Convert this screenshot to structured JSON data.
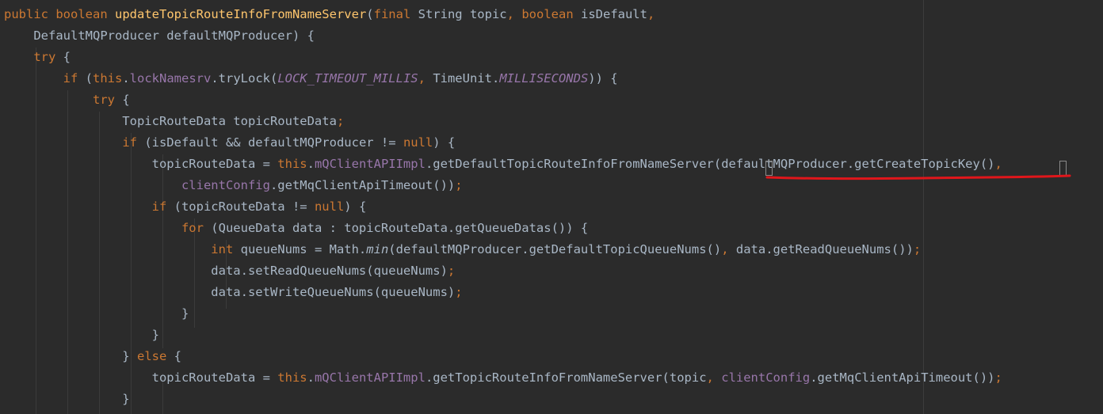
{
  "editor": {
    "colors": {
      "background": "#2b2b2b",
      "keyword": "#cc7832",
      "method_declaration": "#ffc66d",
      "field": "#9876aa",
      "default_text": "#a9b7c6",
      "annotation_underline": "#e0161b"
    },
    "lines": [
      [
        {
          "t": "public",
          "k": "kw"
        },
        {
          "t": " ",
          "k": "plain"
        },
        {
          "t": "boolean",
          "k": "kw"
        },
        {
          "t": " ",
          "k": "plain"
        },
        {
          "t": "updateTopicRouteInfoFromNameServer",
          "k": "fn"
        },
        {
          "t": "(",
          "k": "plain"
        },
        {
          "t": "final",
          "k": "kw"
        },
        {
          "t": " String topic",
          "k": "plain"
        },
        {
          "t": ",",
          "k": "punc"
        },
        {
          "t": " ",
          "k": "plain"
        },
        {
          "t": "boolean",
          "k": "kw"
        },
        {
          "t": " isDefault",
          "k": "plain"
        },
        {
          "t": ",",
          "k": "punc"
        }
      ],
      [
        {
          "t": "    DefaultMQProducer defaultMQProducer) {",
          "k": "plain"
        }
      ],
      [
        {
          "t": "    ",
          "k": "plain"
        },
        {
          "t": "try",
          "k": "kw"
        },
        {
          "t": " {",
          "k": "plain"
        }
      ],
      [
        {
          "t": "        ",
          "k": "plain"
        },
        {
          "t": "if",
          "k": "kw"
        },
        {
          "t": " (",
          "k": "plain"
        },
        {
          "t": "this",
          "k": "kw"
        },
        {
          "t": ".",
          "k": "plain"
        },
        {
          "t": "lockNamesrv",
          "k": "fld"
        },
        {
          "t": ".tryLock(",
          "k": "plain"
        },
        {
          "t": "LOCK_TIMEOUT_MILLIS",
          "k": "const"
        },
        {
          "t": ",",
          "k": "punc"
        },
        {
          "t": " TimeUnit.",
          "k": "plain"
        },
        {
          "t": "MILLISECONDS",
          "k": "const"
        },
        {
          "t": ")) {",
          "k": "plain"
        }
      ],
      [
        {
          "t": "            ",
          "k": "plain"
        },
        {
          "t": "try",
          "k": "kw"
        },
        {
          "t": " {",
          "k": "plain"
        }
      ],
      [
        {
          "t": "                TopicRouteData topicRouteData",
          "k": "plain"
        },
        {
          "t": ";",
          "k": "punc"
        }
      ],
      [
        {
          "t": "                ",
          "k": "plain"
        },
        {
          "t": "if",
          "k": "kw"
        },
        {
          "t": " (isDefault && defaultMQProducer != ",
          "k": "plain"
        },
        {
          "t": "null",
          "k": "kw"
        },
        {
          "t": ") {",
          "k": "plain"
        }
      ],
      [
        {
          "t": "                    topicRouteData = ",
          "k": "plain"
        },
        {
          "t": "this",
          "k": "kw"
        },
        {
          "t": ".",
          "k": "plain"
        },
        {
          "t": "mQClientAPIImpl",
          "k": "fld"
        },
        {
          "t": ".getDefaultTopicRouteInfoFromNameServer(defaultMQProducer.getCreateTopicKey()",
          "k": "plain"
        },
        {
          "t": ",",
          "k": "punc"
        }
      ],
      [
        {
          "t": "                        ",
          "k": "plain"
        },
        {
          "t": "clientConfig",
          "k": "fld"
        },
        {
          "t": ".getMqClientApiTimeout())",
          "k": "plain"
        },
        {
          "t": ";",
          "k": "punc"
        }
      ],
      [
        {
          "t": "                    ",
          "k": "plain"
        },
        {
          "t": "if",
          "k": "kw"
        },
        {
          "t": " (topicRouteData != ",
          "k": "plain"
        },
        {
          "t": "null",
          "k": "kw"
        },
        {
          "t": ") {",
          "k": "plain"
        }
      ],
      [
        {
          "t": "                        ",
          "k": "plain"
        },
        {
          "t": "for",
          "k": "kw"
        },
        {
          "t": " (QueueData data : topicRouteData.getQueueDatas()) {",
          "k": "plain"
        }
      ],
      [
        {
          "t": "                            ",
          "k": "plain"
        },
        {
          "t": "int",
          "k": "kw"
        },
        {
          "t": " queueNums = Math.",
          "k": "plain"
        },
        {
          "t": "min",
          "k": "static"
        },
        {
          "t": "(defaultMQProducer.getDefaultTopicQueueNums()",
          "k": "plain"
        },
        {
          "t": ",",
          "k": "punc"
        },
        {
          "t": " data.getReadQueueNums())",
          "k": "plain"
        },
        {
          "t": ";",
          "k": "punc"
        }
      ],
      [
        {
          "t": "                            data.setReadQueueNums(queueNums)",
          "k": "plain"
        },
        {
          "t": ";",
          "k": "punc"
        }
      ],
      [
        {
          "t": "                            data.setWriteQueueNums(queueNums)",
          "k": "plain"
        },
        {
          "t": ";",
          "k": "punc"
        }
      ],
      [
        {
          "t": "                        }",
          "k": "plain"
        }
      ],
      [
        {
          "t": "                    }",
          "k": "plain"
        }
      ],
      [
        {
          "t": "                } ",
          "k": "plain"
        },
        {
          "t": "else",
          "k": "kw"
        },
        {
          "t": " {",
          "k": "plain"
        }
      ],
      [
        {
          "t": "                    topicRouteData = ",
          "k": "plain"
        },
        {
          "t": "this",
          "k": "kw"
        },
        {
          "t": ".",
          "k": "plain"
        },
        {
          "t": "mQClientAPIImpl",
          "k": "fld"
        },
        {
          "t": ".getTopicRouteInfoFromNameServer(topic",
          "k": "plain"
        },
        {
          "t": ",",
          "k": "punc"
        },
        {
          "t": " ",
          "k": "plain"
        },
        {
          "t": "clientConfig",
          "k": "fld"
        },
        {
          "t": ".getMqClientApiTimeout())",
          "k": "plain"
        },
        {
          "t": ";",
          "k": "punc"
        }
      ],
      [
        {
          "t": "                }",
          "k": "plain"
        }
      ]
    ]
  }
}
